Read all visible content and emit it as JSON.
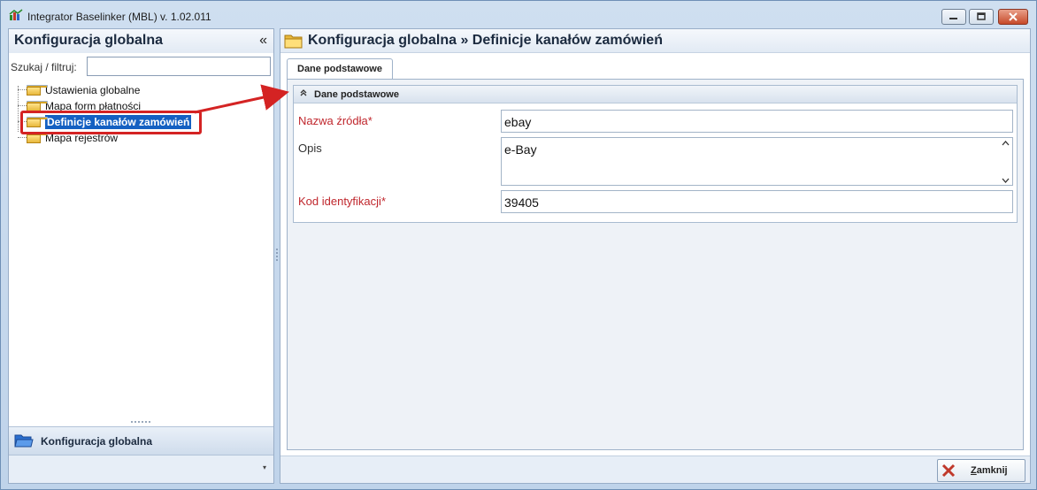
{
  "window": {
    "title": "Integrator Baselinker (MBL) v. 1.02.011",
    "minimize_icon": "minimize-icon",
    "restore_icon": "restore-icon",
    "close_icon": "close-icon"
  },
  "left_panel": {
    "title": "Konfiguracja globalna",
    "collapse_label": "«",
    "filter_label": "Szukaj / filtruj:",
    "filter_value": "",
    "tree": [
      {
        "label": "Ustawienia globalne",
        "selected": false
      },
      {
        "label": "Mapa form płatności",
        "selected": false
      },
      {
        "label": "Definicje kanałów zamówień",
        "selected": true
      },
      {
        "label": "Mapa rejestrów",
        "selected": false
      }
    ],
    "nav_title": "Konfiguracja globalna",
    "nav_dropdown": "▾"
  },
  "right_panel": {
    "title": "Konfiguracja globalna » Definicje kanałów zamówień",
    "tab_label": "Dane podstawowe",
    "group_title": "Dane podstawowe",
    "fields": {
      "source_name_label": "Nazwa źródła*",
      "source_name_value": "ebay",
      "description_label": "Opis",
      "description_value": "e-Bay",
      "id_code_label": "Kod identyfikacji*",
      "id_code_value": "39405"
    },
    "close_button": {
      "label_first": "Z",
      "label_rest": "amknij"
    }
  },
  "colors": {
    "required_label": "#c0272d",
    "selection": "#1460c2",
    "annotation": "#d42323"
  }
}
